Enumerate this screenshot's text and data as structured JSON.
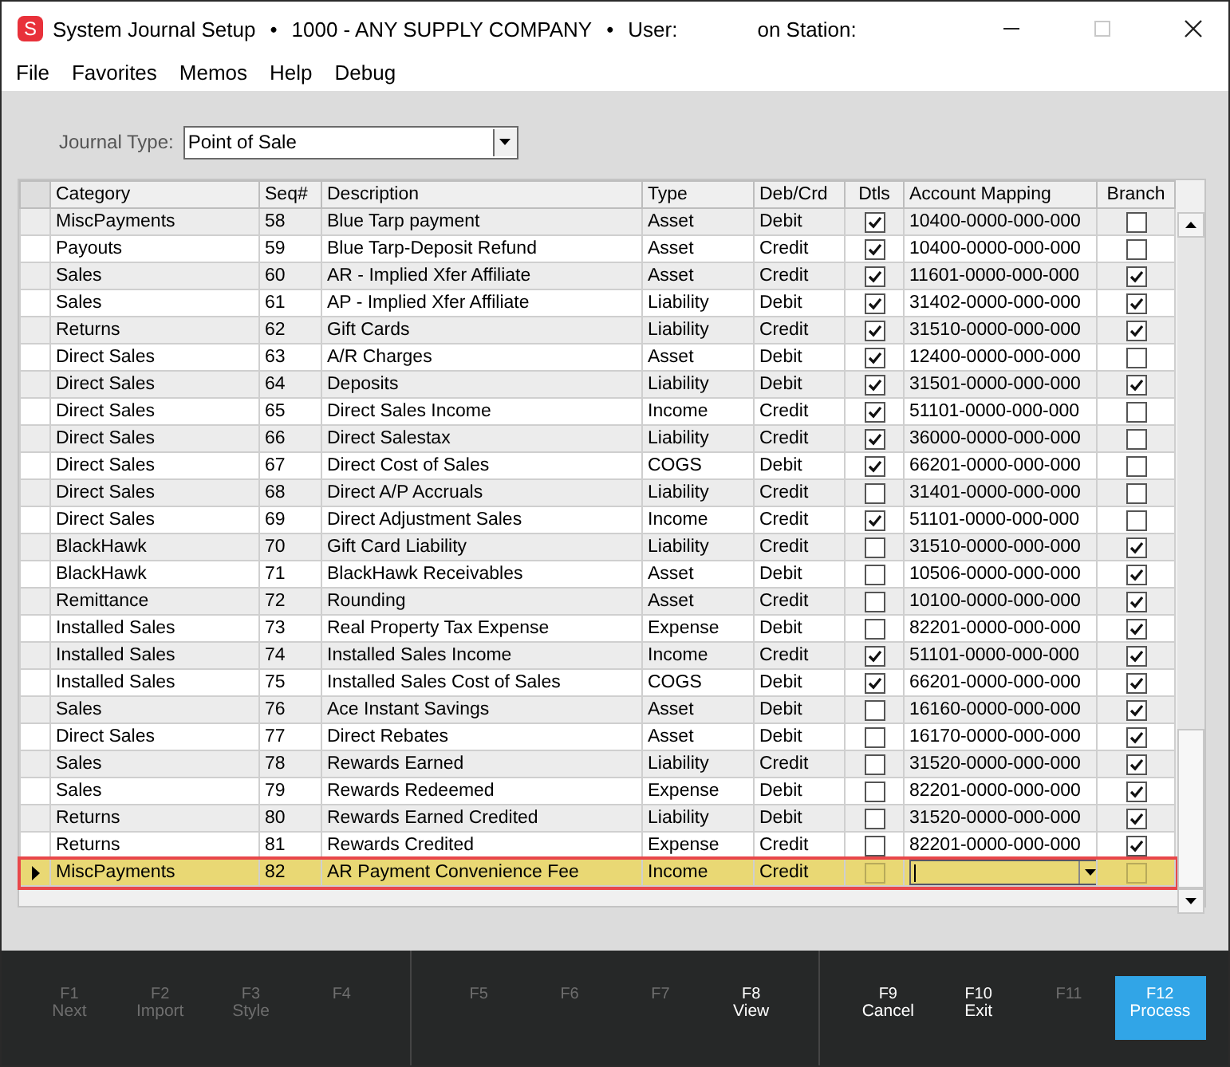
{
  "window": {
    "app_icon_letter": "S",
    "title": "System Journal Setup",
    "separator_1": "•",
    "company": "1000 - ANY SUPPLY COMPANY",
    "separator_2": "•",
    "user_label": "User:",
    "station_label": "on Station:"
  },
  "menu": [
    "File",
    "Favorites",
    "Memos",
    "Help",
    "Debug"
  ],
  "journal_type": {
    "label": "Journal Type:",
    "value": "Point of Sale"
  },
  "table": {
    "columns": [
      "Category",
      "Seq#",
      "Description",
      "Type",
      "Deb/Crd",
      "Dtls",
      "Account Mapping",
      "Branch"
    ],
    "rows": [
      {
        "category": "MiscPayments",
        "seq": "58",
        "description": "Blue Tarp payment",
        "type": "Asset",
        "deb_crd": "Debit",
        "dtls": true,
        "account": "10400-0000-000-000",
        "branch": false,
        "selected": false
      },
      {
        "category": "Payouts",
        "seq": "59",
        "description": "Blue Tarp-Deposit Refund",
        "type": "Asset",
        "deb_crd": "Credit",
        "dtls": true,
        "account": "10400-0000-000-000",
        "branch": false,
        "selected": false
      },
      {
        "category": "Sales",
        "seq": "60",
        "description": "AR - Implied Xfer Affiliate",
        "type": "Asset",
        "deb_crd": "Credit",
        "dtls": true,
        "account": "11601-0000-000-000",
        "branch": true,
        "selected": false
      },
      {
        "category": "Sales",
        "seq": "61",
        "description": "AP - Implied Xfer Affiliate",
        "type": "Liability",
        "deb_crd": "Debit",
        "dtls": true,
        "account": "31402-0000-000-000",
        "branch": true,
        "selected": false
      },
      {
        "category": "Returns",
        "seq": "62",
        "description": "Gift Cards",
        "type": "Liability",
        "deb_crd": "Credit",
        "dtls": true,
        "account": "31510-0000-000-000",
        "branch": true,
        "selected": false
      },
      {
        "category": "Direct Sales",
        "seq": "63",
        "description": "A/R Charges",
        "type": "Asset",
        "deb_crd": "Debit",
        "dtls": true,
        "account": "12400-0000-000-000",
        "branch": false,
        "selected": false
      },
      {
        "category": "Direct Sales",
        "seq": "64",
        "description": "Deposits",
        "type": "Liability",
        "deb_crd": "Debit",
        "dtls": true,
        "account": "31501-0000-000-000",
        "branch": true,
        "selected": false
      },
      {
        "category": "Direct Sales",
        "seq": "65",
        "description": "Direct Sales Income",
        "type": "Income",
        "deb_crd": "Credit",
        "dtls": true,
        "account": "51101-0000-000-000",
        "branch": false,
        "selected": false
      },
      {
        "category": "Direct Sales",
        "seq": "66",
        "description": "Direct Salestax",
        "type": "Liability",
        "deb_crd": "Credit",
        "dtls": true,
        "account": "36000-0000-000-000",
        "branch": false,
        "selected": false
      },
      {
        "category": "Direct Sales",
        "seq": "67",
        "description": "Direct Cost of Sales",
        "type": "COGS",
        "deb_crd": "Debit",
        "dtls": true,
        "account": "66201-0000-000-000",
        "branch": false,
        "selected": false
      },
      {
        "category": "Direct Sales",
        "seq": "68",
        "description": "Direct A/P Accruals",
        "type": "Liability",
        "deb_crd": "Credit",
        "dtls": false,
        "account": "31401-0000-000-000",
        "branch": false,
        "selected": false
      },
      {
        "category": "Direct Sales",
        "seq": "69",
        "description": "Direct Adjustment Sales",
        "type": "Income",
        "deb_crd": "Credit",
        "dtls": true,
        "account": "51101-0000-000-000",
        "branch": false,
        "selected": false
      },
      {
        "category": "BlackHawk",
        "seq": "70",
        "description": "Gift Card Liability",
        "type": "Liability",
        "deb_crd": "Credit",
        "dtls": false,
        "account": "31510-0000-000-000",
        "branch": true,
        "selected": false
      },
      {
        "category": "BlackHawk",
        "seq": "71",
        "description": "BlackHawk Receivables",
        "type": "Asset",
        "deb_crd": "Debit",
        "dtls": false,
        "account": "10506-0000-000-000",
        "branch": true,
        "selected": false
      },
      {
        "category": "Remittance",
        "seq": "72",
        "description": "Rounding",
        "type": "Asset",
        "deb_crd": "Credit",
        "dtls": false,
        "account": "10100-0000-000-000",
        "branch": true,
        "selected": false
      },
      {
        "category": "Installed Sales",
        "seq": "73",
        "description": "Real Property Tax Expense",
        "type": "Expense",
        "deb_crd": "Debit",
        "dtls": false,
        "account": "82201-0000-000-000",
        "branch": true,
        "selected": false
      },
      {
        "category": "Installed Sales",
        "seq": "74",
        "description": "Installed Sales Income",
        "type": "Income",
        "deb_crd": "Credit",
        "dtls": true,
        "account": "51101-0000-000-000",
        "branch": true,
        "selected": false
      },
      {
        "category": "Installed Sales",
        "seq": "75",
        "description": "Installed Sales Cost of Sales",
        "type": "COGS",
        "deb_crd": "Debit",
        "dtls": true,
        "account": "66201-0000-000-000",
        "branch": true,
        "selected": false
      },
      {
        "category": "Sales",
        "seq": "76",
        "description": "Ace Instant Savings",
        "type": "Asset",
        "deb_crd": "Debit",
        "dtls": false,
        "account": "16160-0000-000-000",
        "branch": true,
        "selected": false
      },
      {
        "category": "Direct Sales",
        "seq": "77",
        "description": "Direct Rebates",
        "type": "Asset",
        "deb_crd": "Debit",
        "dtls": false,
        "account": "16170-0000-000-000",
        "branch": true,
        "selected": false
      },
      {
        "category": "Sales",
        "seq": "78",
        "description": "Rewards Earned",
        "type": "Liability",
        "deb_crd": "Credit",
        "dtls": false,
        "account": "31520-0000-000-000",
        "branch": true,
        "selected": false
      },
      {
        "category": "Sales",
        "seq": "79",
        "description": "Rewards Redeemed",
        "type": "Expense",
        "deb_crd": "Debit",
        "dtls": false,
        "account": "82201-0000-000-000",
        "branch": true,
        "selected": false
      },
      {
        "category": "Returns",
        "seq": "80",
        "description": "Rewards Earned Credited",
        "type": "Liability",
        "deb_crd": "Debit",
        "dtls": false,
        "account": "31520-0000-000-000",
        "branch": true,
        "selected": false
      },
      {
        "category": "Returns",
        "seq": "81",
        "description": "Rewards Credited",
        "type": "Expense",
        "deb_crd": "Credit",
        "dtls": false,
        "account": "82201-0000-000-000",
        "branch": true,
        "selected": false
      },
      {
        "category": "MiscPayments",
        "seq": "82",
        "description": "AR Payment Convenience Fee",
        "type": "Income",
        "deb_crd": "Credit",
        "dtls": false,
        "branch": false,
        "selected": true
      }
    ]
  },
  "function_keys": [
    {
      "key": "F1",
      "label": "Next",
      "disabled": true,
      "primary": false
    },
    {
      "key": "F2",
      "label": "Import",
      "disabled": true,
      "primary": false
    },
    {
      "key": "F3",
      "label": "Style",
      "disabled": true,
      "primary": false
    },
    {
      "key": "F4",
      "disabled": true,
      "primary": false
    },
    {
      "key": "F5",
      "disabled": true,
      "primary": false
    },
    {
      "key": "F6",
      "disabled": true,
      "primary": false
    },
    {
      "key": "F7",
      "disabled": true,
      "primary": false
    },
    {
      "key": "F8",
      "label": "View",
      "disabled": false,
      "primary": false
    },
    {
      "key": "F9",
      "label": "Cancel",
      "disabled": false,
      "primary": false
    },
    {
      "key": "F10",
      "label": "Exit",
      "disabled": false,
      "primary": false
    },
    {
      "key": "F11",
      "disabled": true,
      "primary": false
    },
    {
      "key": "F12",
      "label": "Process",
      "disabled": false,
      "primary": true
    }
  ]
}
